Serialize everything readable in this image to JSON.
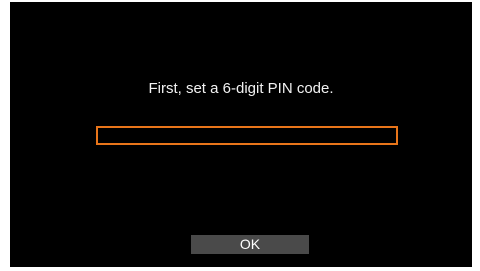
{
  "dialog": {
    "prompt": "First, set a 6-digit PIN code.",
    "pin_value": "",
    "ok_label": "OK"
  },
  "colors": {
    "background": "#000000",
    "field_border": "#e8751a",
    "button_background": "#4a4a4a",
    "text": "#f2f2f2"
  }
}
